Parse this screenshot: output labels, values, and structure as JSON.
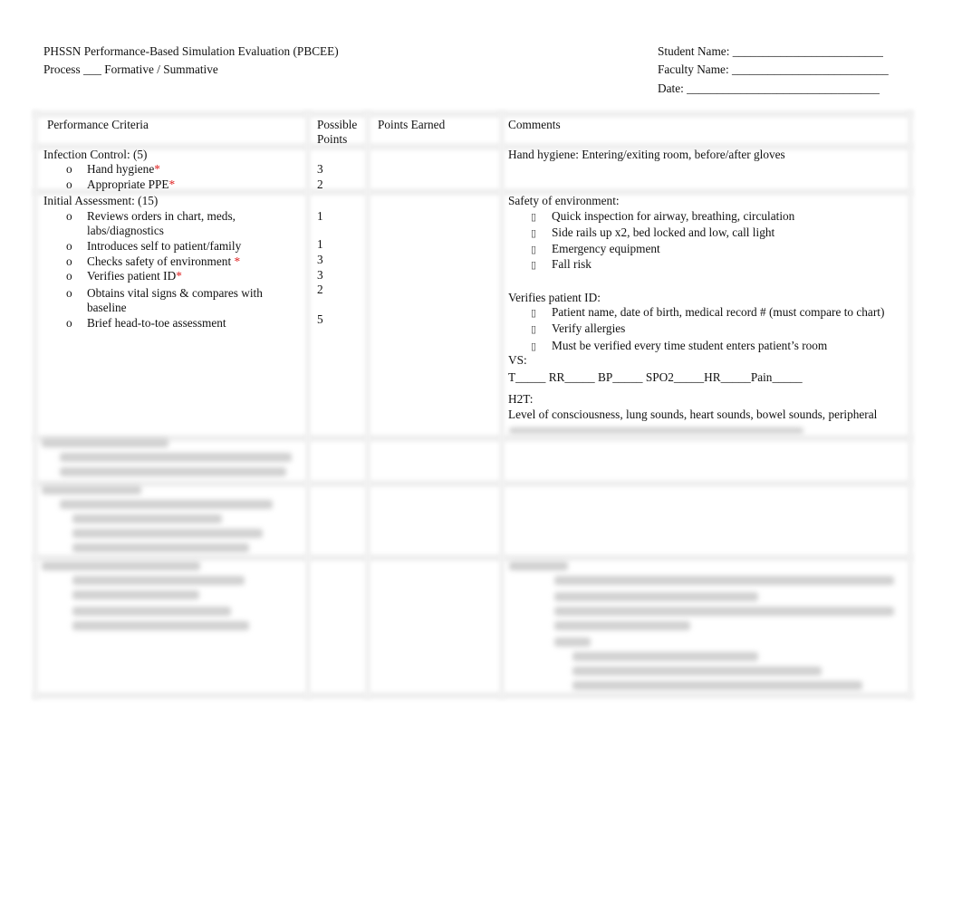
{
  "header": {
    "title": "PHSSN Performance-Based Simulation Evaluation (PBCEE)",
    "process": "Process ___ Formative / Summative",
    "student_name": "Student Name: _________________________",
    "faculty_name": "Faculty Name: __________________________",
    "date": "Date: ________________________________"
  },
  "table": {
    "headers": [
      "Performance Criteria",
      "Possible",
      "Points",
      "Points Earned",
      "Comments"
    ],
    "sections": [
      {
        "title": "Infection Control: (5)",
        "items": [
          {
            "bullet": "o",
            "label": "Hand hygiene",
            "required": true,
            "points": "3"
          },
          {
            "bullet": "o",
            "label": "Appropriate PPE",
            "required": true,
            "points": "2"
          }
        ]
      },
      {
        "title": "Initial Assessment: (15)",
        "items": [
          {
            "bullet": "o",
            "label": "Reviews orders in chart, meds,",
            "label2": "labs/diagnostics",
            "required": false,
            "points": "1"
          },
          {
            "bullet": "o",
            "label": "Introduces self to patient/family",
            "required": false,
            "points": "1"
          },
          {
            "bullet": "o",
            "label": "Checks safety of environment ",
            "required": true,
            "points": "3"
          },
          {
            "bullet": "o",
            "label": "Verifies patient ID",
            "required": true,
            "points": "3"
          },
          {
            "bullet": "o",
            "label": "Obtains vital signs & compares with",
            "label2": "baseline",
            "required": false,
            "points": "2"
          },
          {
            "bullet": "o",
            "label": "Brief head-to-toe assessment",
            "required": false,
            "points": "5"
          }
        ]
      }
    ],
    "required_mark": "*",
    "comments": {
      "hand_hygiene": "Hand hygiene:  Entering/exiting room, before/after gloves",
      "safety_title": "Safety of environment:",
      "safety_items": [
        "Quick inspection for airway, breathing, circulation",
        "Side rails up x2, bed locked and low, call light",
        "Emergency equipment",
        "Fall risk"
      ],
      "id_title": "Verifies patient ID:",
      "id_items": [
        "Patient name, date of birth, medical record # (must compare to chart)",
        "Verify allergies",
        "Must be verified every time student enters patient’s room"
      ],
      "vs_title": "VS:",
      "vs_line": "T_____ RR_____ BP_____ SPO2_____HR_____Pain_____",
      "h2t_title": "H2T:",
      "h2t_text": "Level of consciousness, lung sounds, heart sounds, bowel sounds, peripheral"
    },
    "checkbox_icon": "checkbox-square-icon"
  }
}
